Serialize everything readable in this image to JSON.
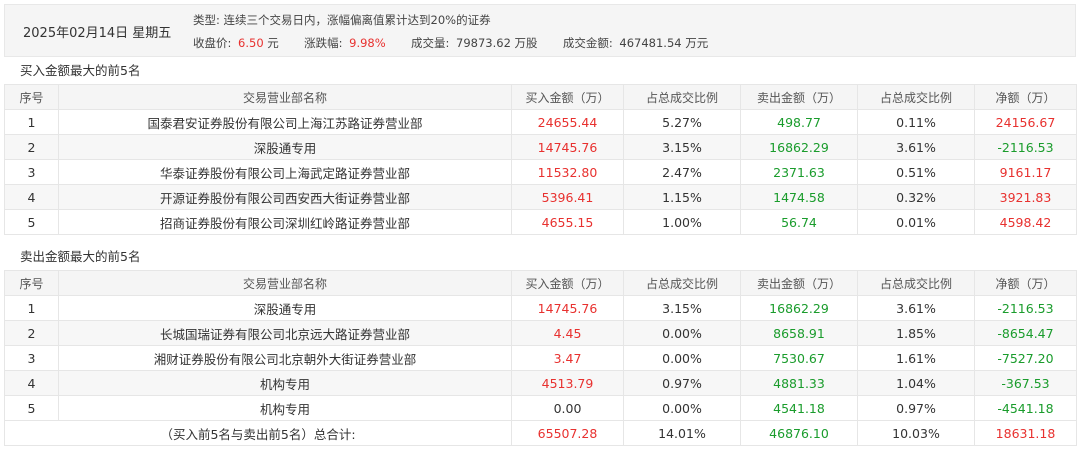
{
  "header": {
    "date": "2025年02月14日 星期五",
    "type_label": "类型:",
    "type_value": "连续三个交易日内，涨幅偏离值累计达到20%的证券",
    "close_label": "收盘价:",
    "close_value": "6.50",
    "close_unit": "元",
    "change_label": "涨跌幅:",
    "change_value": "9.98%",
    "volume_label": "成交量:",
    "volume_value": "79873.62 万股",
    "amount_label": "成交金额:",
    "amount_value": "467481.54 万元"
  },
  "columns": [
    "序号",
    "交易营业部名称",
    "买入金额（万）",
    "占总成交比例",
    "卖出金额（万）",
    "占总成交比例",
    "净额（万）"
  ],
  "buy_section": {
    "title": "买入金额最大的前5名",
    "rows": [
      {
        "no": "1",
        "name": "国泰君安证券股份有限公司上海江苏路证券营业部",
        "buy": "24655.44",
        "buy_pct": "5.27%",
        "sell": "498.77",
        "sell_pct": "0.11%",
        "net": "24156.67",
        "net_sign": "up"
      },
      {
        "no": "2",
        "name": "深股通专用",
        "buy": "14745.76",
        "buy_pct": "3.15%",
        "sell": "16862.29",
        "sell_pct": "3.61%",
        "net": "-2116.53",
        "net_sign": "down"
      },
      {
        "no": "3",
        "name": "华泰证券股份有限公司上海武定路证券营业部",
        "buy": "11532.80",
        "buy_pct": "2.47%",
        "sell": "2371.63",
        "sell_pct": "0.51%",
        "net": "9161.17",
        "net_sign": "up"
      },
      {
        "no": "4",
        "name": "开源证券股份有限公司西安西大街证券营业部",
        "buy": "5396.41",
        "buy_pct": "1.15%",
        "sell": "1474.58",
        "sell_pct": "0.32%",
        "net": "3921.83",
        "net_sign": "up"
      },
      {
        "no": "5",
        "name": "招商证券股份有限公司深圳红岭路证券营业部",
        "buy": "4655.15",
        "buy_pct": "1.00%",
        "sell": "56.74",
        "sell_pct": "0.01%",
        "net": "4598.42",
        "net_sign": "up"
      }
    ]
  },
  "sell_section": {
    "title": "卖出金额最大的前5名",
    "rows": [
      {
        "no": "1",
        "name": "深股通专用",
        "buy": "14745.76",
        "buy_pct": "3.15%",
        "sell": "16862.29",
        "sell_pct": "3.61%",
        "net": "-2116.53",
        "net_sign": "down"
      },
      {
        "no": "2",
        "name": "长城国瑞证券有限公司北京远大路证券营业部",
        "buy": "4.45",
        "buy_pct": "0.00%",
        "sell": "8658.91",
        "sell_pct": "1.85%",
        "net": "-8654.47",
        "net_sign": "down"
      },
      {
        "no": "3",
        "name": "湘财证券股份有限公司北京朝外大街证券营业部",
        "buy": "3.47",
        "buy_pct": "0.00%",
        "sell": "7530.67",
        "sell_pct": "1.61%",
        "net": "-7527.20",
        "net_sign": "down"
      },
      {
        "no": "4",
        "name": "机构专用",
        "buy": "4513.79",
        "buy_pct": "0.97%",
        "sell": "4881.33",
        "sell_pct": "1.04%",
        "net": "-367.53",
        "net_sign": "down"
      },
      {
        "no": "5",
        "name": "机构专用",
        "buy": "0.00",
        "buy_pct": "0.00%",
        "sell": "4541.18",
        "sell_pct": "0.97%",
        "net": "-4541.18",
        "net_sign": "down",
        "buy_neutral": true
      }
    ]
  },
  "total": {
    "label": "（买入前5名与卖出前5名）总合计:",
    "buy": "65507.28",
    "buy_pct": "14.01%",
    "sell": "46876.10",
    "sell_pct": "10.03%",
    "net": "18631.18",
    "net_sign": "up"
  },
  "colors": {
    "up": "#e8312f",
    "down": "#1a9c2c",
    "header_bg": "#f5f5f5"
  }
}
